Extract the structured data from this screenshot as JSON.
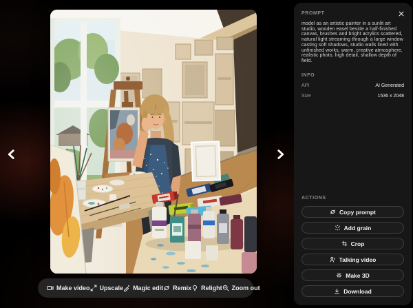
{
  "image": {
    "alt": "AI generated photo: woman painter seated beside a wooden easel in a sunlit art studio, large window at left, blank canvases lining the walls, paint supplies scattered on wooden tables"
  },
  "navigation": {
    "prev_icon": "chevron-left-icon",
    "next_icon": "chevron-right-icon"
  },
  "toolbar": {
    "items": [
      {
        "label": "Make video",
        "icon": "video-camera-icon"
      },
      {
        "label": "Upscale",
        "icon": "upscale-arrows-icon"
      },
      {
        "label": "Magic edit",
        "icon": "magic-wand-icon"
      },
      {
        "label": "Remix",
        "icon": "remix-cycle-icon"
      },
      {
        "label": "Relight",
        "icon": "lightbulb-icon"
      },
      {
        "label": "Zoom out",
        "icon": "zoom-out-icon"
      }
    ]
  },
  "panel": {
    "prompt_label": "PROMPT",
    "close_icon": "close-icon",
    "prompt_text": "model as an artistic painter in a sunlit art studio, wooden easel beside a half-finished canvas, brushes and bright acrylics scattered, natural light streaming through a large window casting soft shadows, studio walls lined with unfinished works, warm, creative atmosphere, realistic photo, high detail, shallow depth of field.",
    "info_label": "INFO",
    "info_rows": [
      {
        "label": "API",
        "value": "AI Generated"
      },
      {
        "label": "Size",
        "value": "1536 x 2048"
      }
    ],
    "actions_label": "ACTIONS",
    "actions": [
      {
        "label": "Copy prompt",
        "icon": "copy-prompt-cycle-icon"
      },
      {
        "label": "Add grain",
        "icon": "grain-sparkle-icon"
      },
      {
        "label": "Crop",
        "icon": "crop-icon"
      },
      {
        "label": "Talking video",
        "icon": "talking-person-icon"
      },
      {
        "label": "Make 3D",
        "icon": "gear-icon"
      },
      {
        "label": "Download",
        "icon": "download-icon"
      }
    ]
  }
}
